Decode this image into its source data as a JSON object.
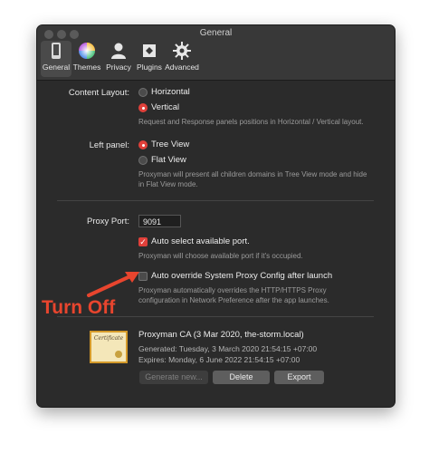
{
  "window": {
    "title": "General"
  },
  "tabs": [
    {
      "label": "General",
      "icon": "phone-icon",
      "selected": true
    },
    {
      "label": "Themes",
      "icon": "color-wheel-icon"
    },
    {
      "label": "Privacy",
      "icon": "user-icon"
    },
    {
      "label": "Plugins",
      "icon": "puzzle-icon"
    },
    {
      "label": "Advanced",
      "icon": "gear-icon"
    }
  ],
  "content_layout": {
    "label": "Content Layout:",
    "options": [
      "Horizontal",
      "Vertical"
    ],
    "selected": "Vertical",
    "help": "Request and Response panels positions in Horizontal / Vertical layout."
  },
  "left_panel": {
    "label": "Left panel:",
    "options": [
      "Tree View",
      "Flat View"
    ],
    "selected": "Tree View",
    "help_line1": "Proxyman will present all children domains in Tree View mode and hide",
    "help_line2": "in Flat View mode."
  },
  "proxy_port": {
    "label": "Proxy Port:",
    "value": "9091",
    "auto_select_label": "Auto select available port.",
    "auto_select_checked": true,
    "auto_select_help": "Proxyman will choose available port if it's occupied.",
    "auto_override_label": "Auto override System Proxy Config after launch",
    "auto_override_checked": false,
    "auto_override_help_line1": "Proxyman automatically overrides the HTTP/HTTPS Proxy",
    "auto_override_help_line2": "configuration in Network Preference after the app launches."
  },
  "certificate": {
    "image_text": "Certificate",
    "name": "Proxyman CA (3 Mar 2020, the-storm.local)",
    "generated": "Generated: Tuesday, 3 March 2020 21:54:15 +07:00",
    "expires": "Expires: Monday, 6 June 2022 21:54:15 +07:00",
    "buttons": {
      "generate": "Generate new...",
      "delete": "Delete",
      "export": "Export"
    }
  },
  "annotation": {
    "text": "Turn Off",
    "color": "#e8452e"
  },
  "colors": {
    "accent": "#e0403a",
    "window_bg": "#2b2b2b",
    "titlebar_bg": "#383838"
  }
}
